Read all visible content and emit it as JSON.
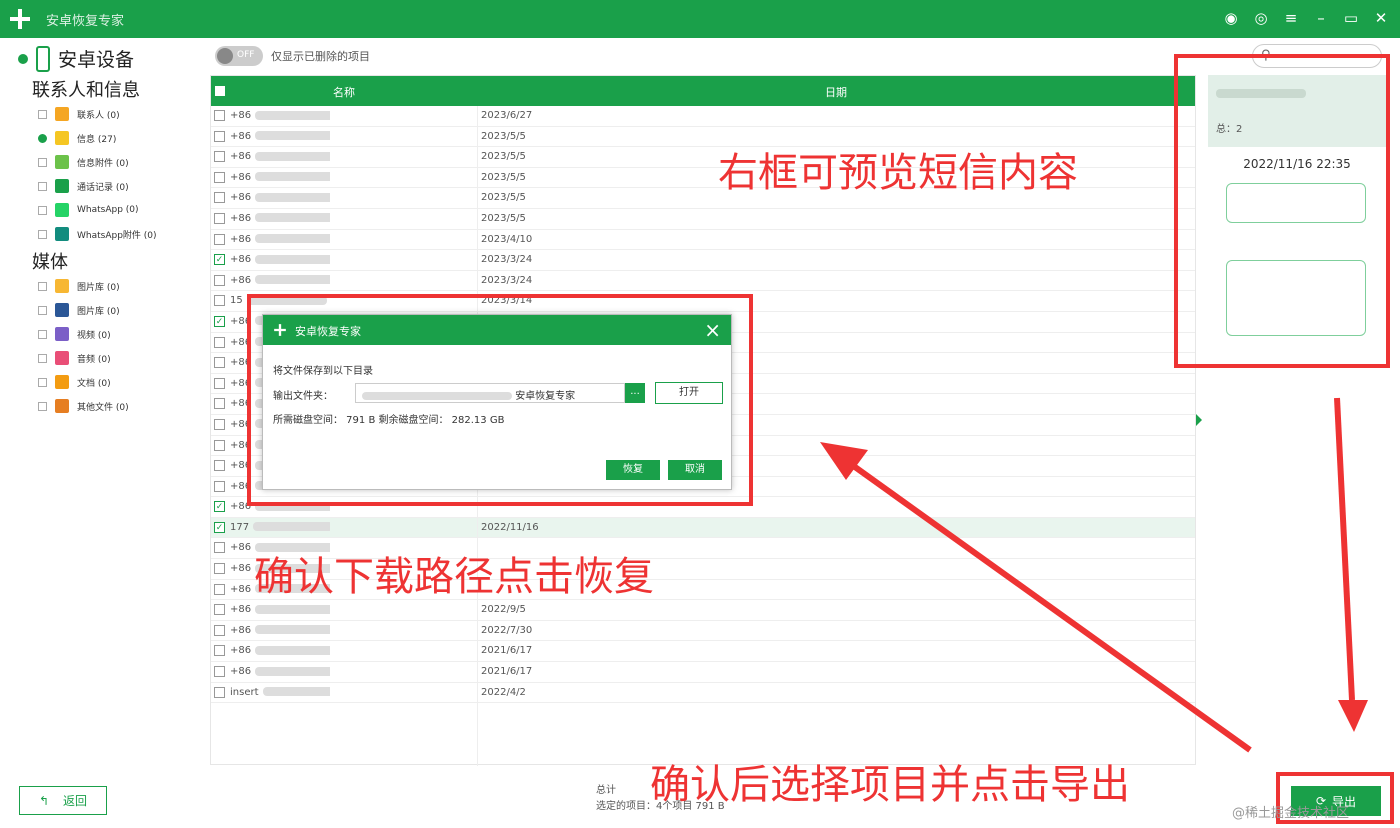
{
  "app": {
    "title": "安卓恢复专家"
  },
  "sidebar": {
    "device": "安卓设备",
    "sections": [
      {
        "title": "联系人和信息",
        "items": [
          {
            "label": "联系人 (0)",
            "color": "#f5a623",
            "checked": false
          },
          {
            "label": "信息 (27)",
            "color": "#f5c623",
            "checked": true
          },
          {
            "label": "信息附件 (0)",
            "color": "#6cc24a",
            "checked": false
          },
          {
            "label": "通话记录 (0)",
            "color": "#1aa04a",
            "checked": false
          },
          {
            "label": "WhatsApp (0)",
            "color": "#25d366",
            "checked": false
          },
          {
            "label": "WhatsApp附件 (0)",
            "color": "#128c7e",
            "checked": false
          }
        ]
      },
      {
        "title": "媒体",
        "items": [
          {
            "label": "图片库 (0)",
            "color": "#f7b733",
            "checked": false
          },
          {
            "label": "图片库 (0)",
            "color": "#2b5797",
            "checked": false
          },
          {
            "label": "视频 (0)",
            "color": "#7b5fc7",
            "checked": false
          },
          {
            "label": "音频 (0)",
            "color": "#e94e77",
            "checked": false
          },
          {
            "label": "文档 (0)",
            "color": "#f39c12",
            "checked": false
          },
          {
            "label": "其他文件 (0)",
            "color": "#e67e22",
            "checked": false
          }
        ]
      }
    ],
    "back_label": "返回"
  },
  "toolbar": {
    "toggle_state": "OFF",
    "toggle_label": "仅显示已删除的项目"
  },
  "grid": {
    "col_name": "名称",
    "col_date": "日期",
    "rows": [
      {
        "name": "+86",
        "date": "2023/6/27",
        "checked": false
      },
      {
        "name": "+86",
        "date": "2023/5/5",
        "checked": false
      },
      {
        "name": "+86",
        "date": "2023/5/5",
        "checked": false
      },
      {
        "name": "+86",
        "date": "2023/5/5",
        "checked": false
      },
      {
        "name": "+86",
        "date": "2023/5/5",
        "checked": false
      },
      {
        "name": "+86",
        "date": "2023/5/5",
        "checked": false
      },
      {
        "name": "+86",
        "date": "2023/4/10",
        "checked": false
      },
      {
        "name": "+86",
        "date": "2023/3/24",
        "checked": true
      },
      {
        "name": "+86",
        "date": "2023/3/24",
        "checked": false
      },
      {
        "name": "15",
        "date": "2023/3/14",
        "checked": false
      },
      {
        "name": "+86",
        "date": "",
        "checked": true
      },
      {
        "name": "+86",
        "date": "",
        "checked": false
      },
      {
        "name": "+86",
        "date": "",
        "checked": false
      },
      {
        "name": "+86",
        "date": "",
        "checked": false
      },
      {
        "name": "+86",
        "date": "",
        "checked": false
      },
      {
        "name": "+86",
        "date": "",
        "checked": false
      },
      {
        "name": "+86",
        "date": "",
        "checked": false
      },
      {
        "name": "+86",
        "date": "",
        "checked": false
      },
      {
        "name": "+86",
        "date": "",
        "checked": false
      },
      {
        "name": "+86",
        "date": "",
        "checked": true
      },
      {
        "name": "177",
        "date": "2022/11/16",
        "checked": true
      },
      {
        "name": "+86",
        "date": "",
        "checked": false
      },
      {
        "name": "+86",
        "date": "",
        "checked": false
      },
      {
        "name": "+86",
        "date": "",
        "checked": false
      },
      {
        "name": "+86",
        "date": "2022/9/5",
        "checked": false
      },
      {
        "name": "+86",
        "date": "2022/7/30",
        "checked": false
      },
      {
        "name": "+86",
        "date": "2021/6/17",
        "checked": false
      },
      {
        "name": "+86",
        "date": "2021/6/17",
        "checked": false
      },
      {
        "name": "insert",
        "date": "2022/4/2",
        "checked": false
      }
    ]
  },
  "status": {
    "line1": "总计",
    "line2": "选定的项目：4个项目 791 B"
  },
  "preview": {
    "header_count": "总：2",
    "time": "2022/11/16 22:35"
  },
  "export_label": "导出",
  "dialog": {
    "title": "安卓恢复专家",
    "line1": "将文件保存到以下目录",
    "out_label": "输出文件夹：",
    "path_suffix": "安卓恢复专家",
    "browse": "...",
    "open": "打开",
    "space_line": "所需磁盘空间：  791 B   剩余磁盘空间：  282.13 GB",
    "restore": "恢复",
    "cancel": "取消",
    "close": "×"
  },
  "annotations": {
    "a1": "右框可预览短信内容",
    "a2": "确认下载路径点击恢复",
    "a3": "确认后选择项目并点击导出",
    "red": "#e33333"
  },
  "watermark": "@稀土掘金技术社区"
}
